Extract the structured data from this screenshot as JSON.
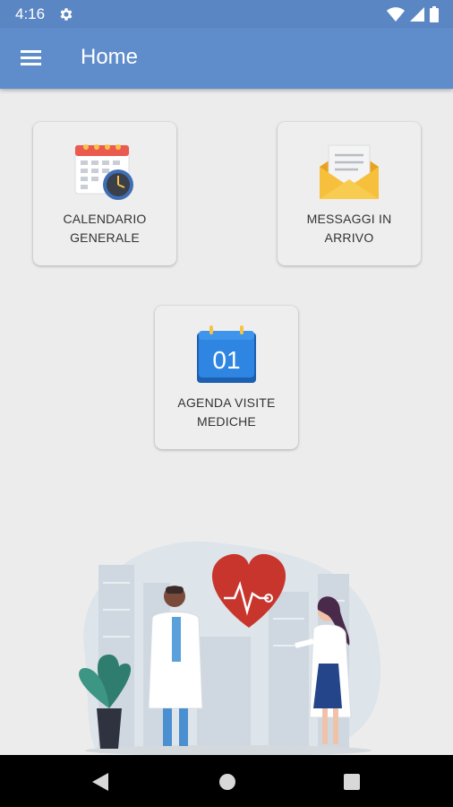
{
  "status_bar": {
    "time": "4:16"
  },
  "app_bar": {
    "title": "Home"
  },
  "cards": [
    {
      "label": "CALENDARIO\nGENERALE",
      "icon": "calendar-clock-icon"
    },
    {
      "label": "MESSAGGI IN\nARRIVO",
      "icon": "envelope-icon"
    },
    {
      "label": "AGENDA VISITE\nMEDICHE",
      "icon": "calendar-day-icon",
      "day": "01"
    }
  ],
  "colors": {
    "app_bar": "#5f8dcb",
    "status_bar": "#5b86c4",
    "background": "#ececec",
    "heart": "#c8352d"
  }
}
